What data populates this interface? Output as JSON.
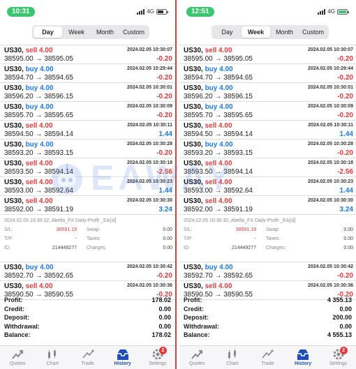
{
  "screens": [
    {
      "clock": "10:31",
      "network": "4G",
      "tabs": [
        {
          "label": "Day",
          "active": true
        },
        {
          "label": "Week",
          "active": false
        },
        {
          "label": "Month",
          "active": false
        },
        {
          "label": "Custom",
          "active": false
        }
      ],
      "trades_top": [
        {
          "symbol": "US30,",
          "side": "sell",
          "volume": "4.00",
          "time": "2024.02.05 10:30:07",
          "prices": "38595.00 → 38595.05",
          "profit": "-0.20"
        },
        {
          "symbol": "US30,",
          "side": "buy",
          "volume": "4.00",
          "time": "2024.02.05 10:29:44",
          "prices": "38594.70 → 38594.65",
          "profit": "-0.20"
        },
        {
          "symbol": "US30,",
          "side": "buy",
          "volume": "4.00",
          "time": "2024.02.05 10:30:01",
          "prices": "38596.20 → 38596.15",
          "profit": "-0.20"
        },
        {
          "symbol": "US30,",
          "side": "buy",
          "volume": "4.00",
          "time": "2024.02.05 10:30:09",
          "prices": "38595.70 → 38595.65",
          "profit": "-0.20"
        },
        {
          "symbol": "US30,",
          "side": "sell",
          "volume": "4.00",
          "time": "2024.02.05 10:30:11",
          "prices": "38594.50 → 38594.14",
          "profit": "1.44"
        },
        {
          "symbol": "US30,",
          "side": "buy",
          "volume": "4.00",
          "time": "2024.02.05 10:30:28",
          "prices": "38593.20 → 38593.15",
          "profit": "-0.20"
        },
        {
          "symbol": "US30,",
          "side": "sell",
          "volume": "4.00",
          "time": "2024.02.05 10:30:18",
          "prices": "38593.50 → 38594.14",
          "profit": "-2.56"
        },
        {
          "symbol": "US30,",
          "side": "sell",
          "volume": "4.00",
          "time": "2024.02.05 10:30:23",
          "prices": "38593.00 → 38592.64",
          "profit": "1.44"
        },
        {
          "symbol": "US30,",
          "side": "sell",
          "volume": "4.00",
          "time": "2024.02.05 10:30:30",
          "prices": "38592.00 → 38591.19",
          "profit": "3.24"
        }
      ],
      "detail": {
        "datetime": "2024.02.05 10:30:32, Abella_FX Daily-Profit _EA[sl]",
        "sl_label": "S/L:",
        "sl_value": "38591.19",
        "swap_label": "Swap:",
        "swap_value": "0.00",
        "tp_label": "T/P:",
        "tp_value": "-",
        "taxes_label": "Taxes:",
        "taxes_value": "0.00",
        "id_label": "ID:",
        "id_value": "214449277",
        "charges_label": "Charges:",
        "charges_value": "0.00"
      },
      "trades_bottom": [
        {
          "symbol": "US30,",
          "side": "buy",
          "volume": "4.00",
          "time": "2024.02.05 10:30:42",
          "prices": "38592.70 → 38592.65",
          "profit": "-0.20"
        },
        {
          "symbol": "US30,",
          "side": "sell",
          "volume": "4.00",
          "time": "2024.02.05 10:30:36",
          "prices": "38590.50 → 38590.55",
          "profit": "-0.20"
        }
      ],
      "summary": [
        {
          "label": "Profit:",
          "value": "178.02"
        },
        {
          "label": "Credit:",
          "value": "0.00"
        },
        {
          "label": "Deposit:",
          "value": "0.00"
        },
        {
          "label": "Withdrawal:",
          "value": "0.00"
        },
        {
          "label": "Balance:",
          "value": "178.02"
        }
      ]
    },
    {
      "clock": "12:51",
      "network": "4G",
      "tabs": [
        {
          "label": "Day",
          "active": false
        },
        {
          "label": "Week",
          "active": true
        },
        {
          "label": "Month",
          "active": false
        },
        {
          "label": "Custom",
          "active": false
        }
      ],
      "trades_top": [
        {
          "symbol": "US30,",
          "side": "sell",
          "volume": "4.00",
          "time": "2024.02.05 10:30:07",
          "prices": "38595.00 → 38595.05",
          "profit": "-0.20"
        },
        {
          "symbol": "US30,",
          "side": "buy",
          "volume": "4.00",
          "time": "2024.02.05 10:29:44",
          "prices": "38594.70 → 38594.65",
          "profit": "-0.20"
        },
        {
          "symbol": "US30,",
          "side": "buy",
          "volume": "4.00",
          "time": "2024.02.05 10:30:01",
          "prices": "38596.20 → 38596.15",
          "profit": "-0.20"
        },
        {
          "symbol": "US30,",
          "side": "buy",
          "volume": "4.00",
          "time": "2024.02.05 10:30:09",
          "prices": "38595.70 → 38595.65",
          "profit": "-0.20"
        },
        {
          "symbol": "US30,",
          "side": "sell",
          "volume": "4.00",
          "time": "2024.02.05 10:30:11",
          "prices": "38594.50 → 38594.14",
          "profit": "1.44"
        },
        {
          "symbol": "US30,",
          "side": "buy",
          "volume": "4.00",
          "time": "2024.02.05 10:30:28",
          "prices": "38593.20 → 38593.15",
          "profit": "-0.20"
        },
        {
          "symbol": "US30,",
          "side": "sell",
          "volume": "4.00",
          "time": "2024.02.05 10:30:18",
          "prices": "38593.50 → 38594.14",
          "profit": "-2.56"
        },
        {
          "symbol": "US30,",
          "side": "sell",
          "volume": "4.00",
          "time": "2024.02.05 10:30:23",
          "prices": "38593.00 → 38592.64",
          "profit": "1.44"
        },
        {
          "symbol": "US30,",
          "side": "sell",
          "volume": "4.00",
          "time": "2024.02.05 10:30:30",
          "prices": "38592.00 → 38591.19",
          "profit": "3.24"
        }
      ],
      "detail": {
        "datetime": "2024.02.05 10:30:32, Abella_FX Daily-Profit _EA[sl]",
        "sl_label": "S/L:",
        "sl_value": "38591.19",
        "swap_label": "Swap:",
        "swap_value": "0.00",
        "tp_label": "T/P:",
        "tp_value": "-",
        "taxes_label": "Taxes:",
        "taxes_value": "0.00",
        "id_label": "ID:",
        "id_value": "214449277",
        "charges_label": "Charges:",
        "charges_value": "0.00"
      },
      "trades_bottom": [
        {
          "symbol": "US30,",
          "side": "buy",
          "volume": "4.00",
          "time": "2024.02.05 10:30:42",
          "prices": "38592.70 → 38592.65",
          "profit": "-0.20"
        },
        {
          "symbol": "US30,",
          "side": "sell",
          "volume": "4.00",
          "time": "2024.02.05 10:30:36",
          "prices": "38590.50 → 38590.55",
          "profit": "-0.20"
        }
      ],
      "summary": [
        {
          "label": "Profit:",
          "value": "4 355.13"
        },
        {
          "label": "Credit:",
          "value": "0.00"
        },
        {
          "label": "Deposit:",
          "value": "200.00"
        },
        {
          "label": "Withdrawal:",
          "value": "0.00"
        },
        {
          "label": "Balance:",
          "value": "4 555.13"
        }
      ]
    }
  ],
  "nav": [
    {
      "label": "Quotes",
      "icon": "quotes-icon",
      "active": false,
      "badge": ""
    },
    {
      "label": "Chart",
      "icon": "chart-icon",
      "active": false,
      "badge": ""
    },
    {
      "label": "Trade",
      "icon": "trade-icon",
      "active": false,
      "badge": ""
    },
    {
      "label": "History",
      "icon": "history-icon",
      "active": true,
      "badge": ""
    },
    {
      "label": "Settings",
      "icon": "settings-icon",
      "active": false,
      "badge": "2"
    }
  ],
  "watermark": {
    "text": "EAWAY",
    "icon": "robot-logo-icon"
  },
  "colors": {
    "sell": "#e33b3b",
    "buy": "#1f7ae0",
    "negative": "#e33b3b",
    "positive": "#1f7ae0",
    "clock_pill": "#39c66d",
    "active_nav": "#1f4fb6"
  }
}
